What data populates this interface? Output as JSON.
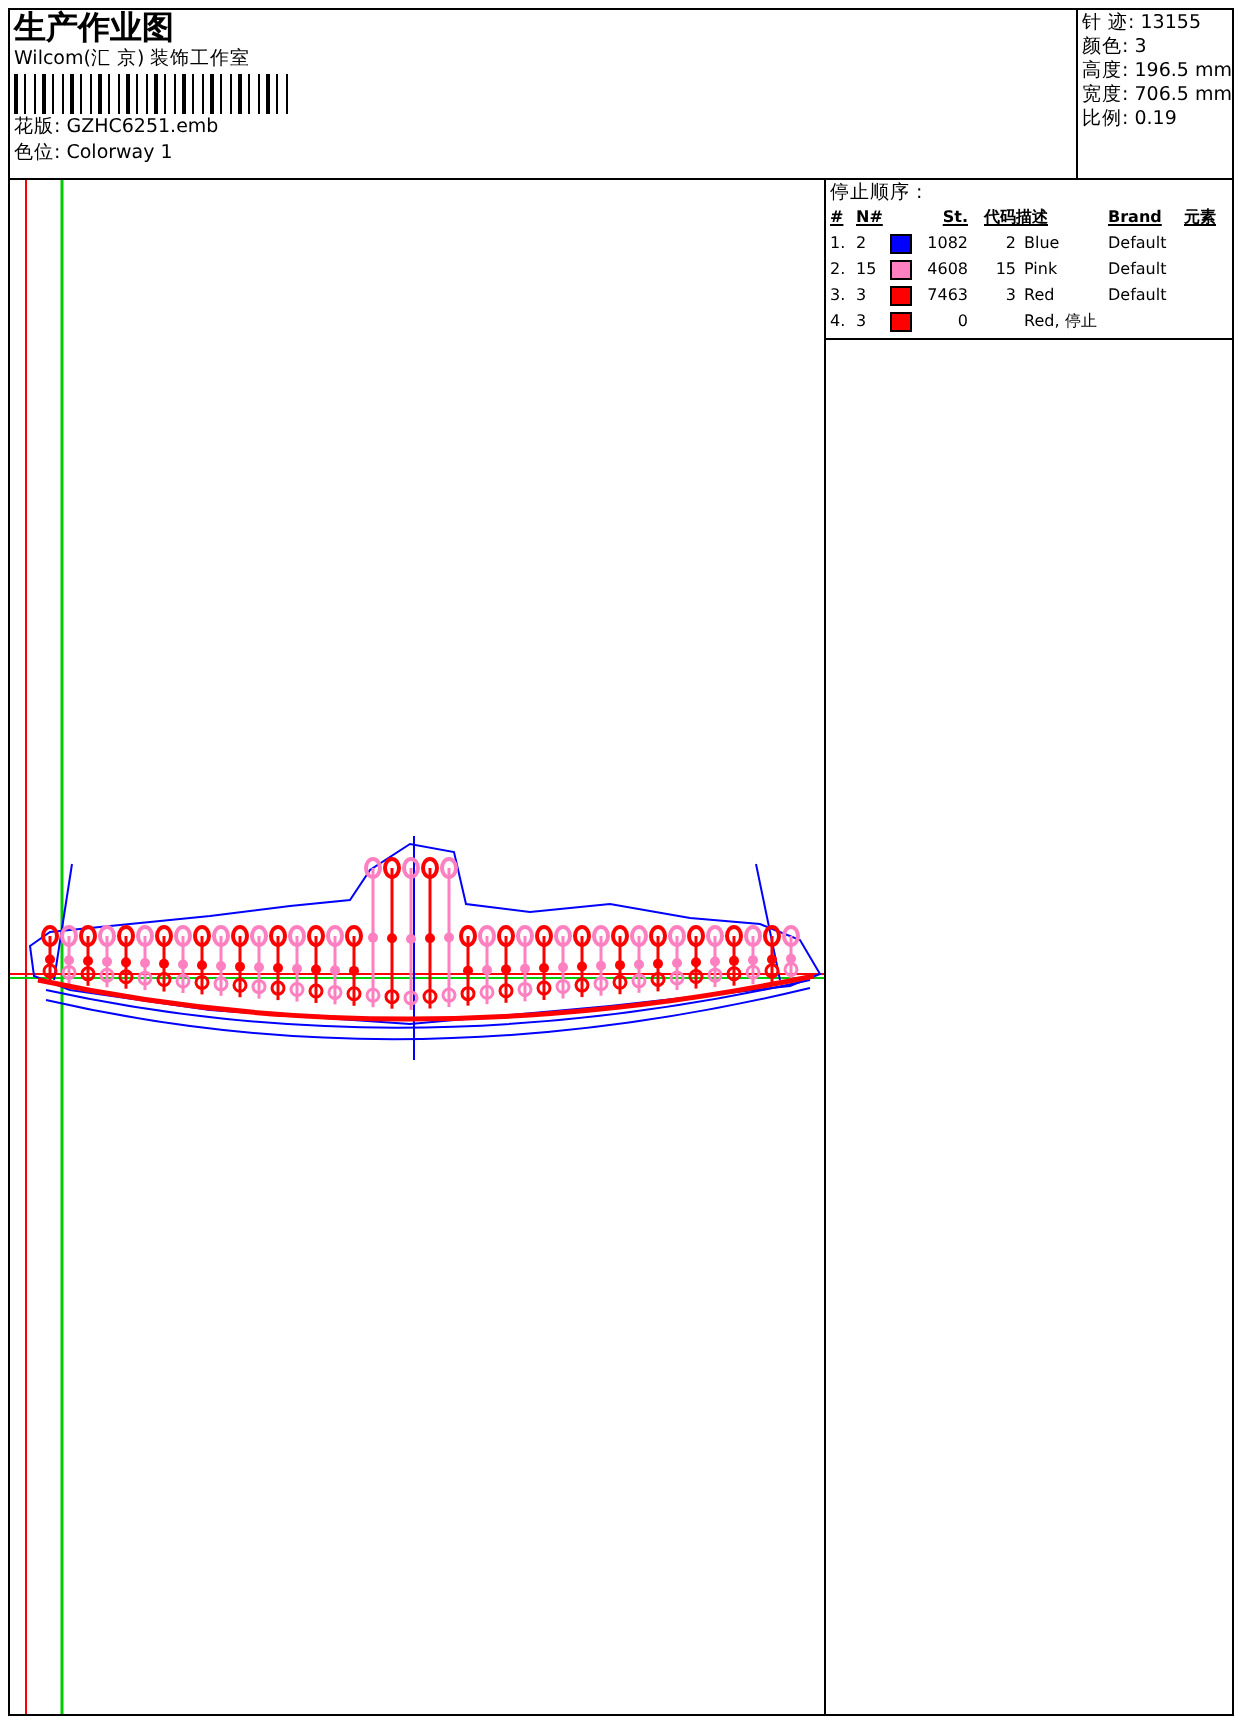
{
  "header": {
    "title": "生产作业图",
    "company": "Wilcom(汇 京) 装饰工作室",
    "design_file": {
      "label": "花版:",
      "value": "GZHC6251.emb"
    },
    "colorway": {
      "label": "色位:",
      "value": "Colorway 1"
    }
  },
  "stats": [
    {
      "label": "针 迹:",
      "value": "13155"
    },
    {
      "label": "颜色:",
      "value": "3"
    },
    {
      "label": "高度:",
      "value": "196.5 mm"
    },
    {
      "label": "宽度:",
      "value": "706.5 mm"
    },
    {
      "label": "比例:",
      "value": "0.19"
    }
  ],
  "stop_sequence": {
    "title": "停止顺序 :",
    "columns": [
      "#",
      "N#",
      "St.",
      "代码",
      "描述",
      "Brand",
      "元素"
    ],
    "rows": [
      {
        "index": "1.",
        "needle": "2",
        "color": "#0000ff",
        "stitches": "1082",
        "code": "2",
        "description": "Blue",
        "brand": "Default"
      },
      {
        "index": "2.",
        "needle": "15",
        "color": "#ff80c0",
        "stitches": "4608",
        "code": "15",
        "description": "Pink",
        "brand": "Default"
      },
      {
        "index": "3.",
        "needle": "3",
        "color": "#ff0000",
        "stitches": "7463",
        "code": "3",
        "description": "Red",
        "brand": "Default"
      },
      {
        "index": "4.",
        "needle": "3",
        "color": "#ff0000",
        "stitches": "0",
        "code": "",
        "description": "Red, 停止",
        "brand": ""
      }
    ]
  }
}
